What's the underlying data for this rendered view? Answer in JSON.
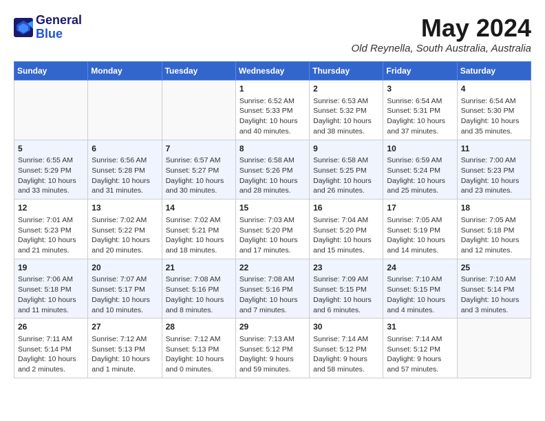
{
  "header": {
    "logo_line1": "General",
    "logo_line2": "Blue",
    "month": "May 2024",
    "location": "Old Reynella, South Australia, Australia"
  },
  "columns": [
    "Sunday",
    "Monday",
    "Tuesday",
    "Wednesday",
    "Thursday",
    "Friday",
    "Saturday"
  ],
  "weeks": [
    [
      {
        "day": "",
        "info": ""
      },
      {
        "day": "",
        "info": ""
      },
      {
        "day": "",
        "info": ""
      },
      {
        "day": "1",
        "info": "Sunrise: 6:52 AM\nSunset: 5:33 PM\nDaylight: 10 hours\nand 40 minutes."
      },
      {
        "day": "2",
        "info": "Sunrise: 6:53 AM\nSunset: 5:32 PM\nDaylight: 10 hours\nand 38 minutes."
      },
      {
        "day": "3",
        "info": "Sunrise: 6:54 AM\nSunset: 5:31 PM\nDaylight: 10 hours\nand 37 minutes."
      },
      {
        "day": "4",
        "info": "Sunrise: 6:54 AM\nSunset: 5:30 PM\nDaylight: 10 hours\nand 35 minutes."
      }
    ],
    [
      {
        "day": "5",
        "info": "Sunrise: 6:55 AM\nSunset: 5:29 PM\nDaylight: 10 hours\nand 33 minutes."
      },
      {
        "day": "6",
        "info": "Sunrise: 6:56 AM\nSunset: 5:28 PM\nDaylight: 10 hours\nand 31 minutes."
      },
      {
        "day": "7",
        "info": "Sunrise: 6:57 AM\nSunset: 5:27 PM\nDaylight: 10 hours\nand 30 minutes."
      },
      {
        "day": "8",
        "info": "Sunrise: 6:58 AM\nSunset: 5:26 PM\nDaylight: 10 hours\nand 28 minutes."
      },
      {
        "day": "9",
        "info": "Sunrise: 6:58 AM\nSunset: 5:25 PM\nDaylight: 10 hours\nand 26 minutes."
      },
      {
        "day": "10",
        "info": "Sunrise: 6:59 AM\nSunset: 5:24 PM\nDaylight: 10 hours\nand 25 minutes."
      },
      {
        "day": "11",
        "info": "Sunrise: 7:00 AM\nSunset: 5:23 PM\nDaylight: 10 hours\nand 23 minutes."
      }
    ],
    [
      {
        "day": "12",
        "info": "Sunrise: 7:01 AM\nSunset: 5:23 PM\nDaylight: 10 hours\nand 21 minutes."
      },
      {
        "day": "13",
        "info": "Sunrise: 7:02 AM\nSunset: 5:22 PM\nDaylight: 10 hours\nand 20 minutes."
      },
      {
        "day": "14",
        "info": "Sunrise: 7:02 AM\nSunset: 5:21 PM\nDaylight: 10 hours\nand 18 minutes."
      },
      {
        "day": "15",
        "info": "Sunrise: 7:03 AM\nSunset: 5:20 PM\nDaylight: 10 hours\nand 17 minutes."
      },
      {
        "day": "16",
        "info": "Sunrise: 7:04 AM\nSunset: 5:20 PM\nDaylight: 10 hours\nand 15 minutes."
      },
      {
        "day": "17",
        "info": "Sunrise: 7:05 AM\nSunset: 5:19 PM\nDaylight: 10 hours\nand 14 minutes."
      },
      {
        "day": "18",
        "info": "Sunrise: 7:05 AM\nSunset: 5:18 PM\nDaylight: 10 hours\nand 12 minutes."
      }
    ],
    [
      {
        "day": "19",
        "info": "Sunrise: 7:06 AM\nSunset: 5:18 PM\nDaylight: 10 hours\nand 11 minutes."
      },
      {
        "day": "20",
        "info": "Sunrise: 7:07 AM\nSunset: 5:17 PM\nDaylight: 10 hours\nand 10 minutes."
      },
      {
        "day": "21",
        "info": "Sunrise: 7:08 AM\nSunset: 5:16 PM\nDaylight: 10 hours\nand 8 minutes."
      },
      {
        "day": "22",
        "info": "Sunrise: 7:08 AM\nSunset: 5:16 PM\nDaylight: 10 hours\nand 7 minutes."
      },
      {
        "day": "23",
        "info": "Sunrise: 7:09 AM\nSunset: 5:15 PM\nDaylight: 10 hours\nand 6 minutes."
      },
      {
        "day": "24",
        "info": "Sunrise: 7:10 AM\nSunset: 5:15 PM\nDaylight: 10 hours\nand 4 minutes."
      },
      {
        "day": "25",
        "info": "Sunrise: 7:10 AM\nSunset: 5:14 PM\nDaylight: 10 hours\nand 3 minutes."
      }
    ],
    [
      {
        "day": "26",
        "info": "Sunrise: 7:11 AM\nSunset: 5:14 PM\nDaylight: 10 hours\nand 2 minutes."
      },
      {
        "day": "27",
        "info": "Sunrise: 7:12 AM\nSunset: 5:13 PM\nDaylight: 10 hours\nand 1 minute."
      },
      {
        "day": "28",
        "info": "Sunrise: 7:12 AM\nSunset: 5:13 PM\nDaylight: 10 hours\nand 0 minutes."
      },
      {
        "day": "29",
        "info": "Sunrise: 7:13 AM\nSunset: 5:12 PM\nDaylight: 9 hours\nand 59 minutes."
      },
      {
        "day": "30",
        "info": "Sunrise: 7:14 AM\nSunset: 5:12 PM\nDaylight: 9 hours\nand 58 minutes."
      },
      {
        "day": "31",
        "info": "Sunrise: 7:14 AM\nSunset: 5:12 PM\nDaylight: 9 hours\nand 57 minutes."
      },
      {
        "day": "",
        "info": ""
      }
    ]
  ]
}
